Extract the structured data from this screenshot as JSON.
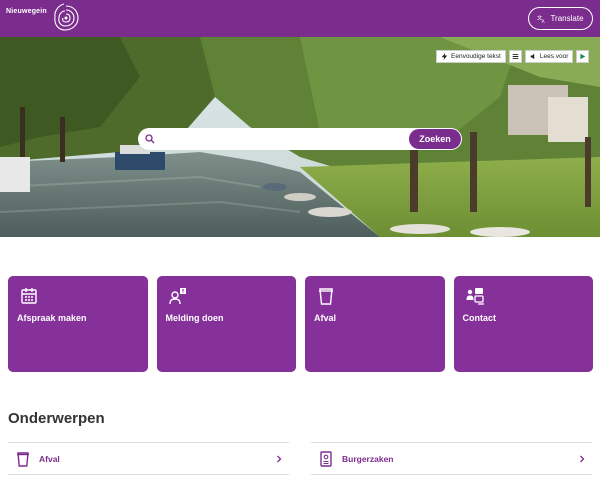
{
  "header": {
    "logo_text": "Nieuwegein",
    "translate_label": "Translate"
  },
  "hero": {
    "a11y": {
      "simple_text_label": "Eenvoudige tekst",
      "read_aloud_label": "Lees voor"
    },
    "search": {
      "placeholder": "",
      "button_label": "Zoeken"
    }
  },
  "tiles": [
    {
      "label": "Afspraak maken",
      "icon": "calendar-icon"
    },
    {
      "label": "Melding doen",
      "icon": "report-person-icon"
    },
    {
      "label": "Afval",
      "icon": "waste-bin-icon"
    },
    {
      "label": "Contact",
      "icon": "contact-chat-icon"
    }
  ],
  "topics": {
    "title": "Onderwerpen",
    "items": [
      {
        "label": "Afval",
        "icon": "waste-bin-icon"
      },
      {
        "label": "Burgerzaken",
        "icon": "document-icon"
      }
    ]
  },
  "colors": {
    "brand": "#7b2d8e",
    "tile": "#86309a"
  }
}
